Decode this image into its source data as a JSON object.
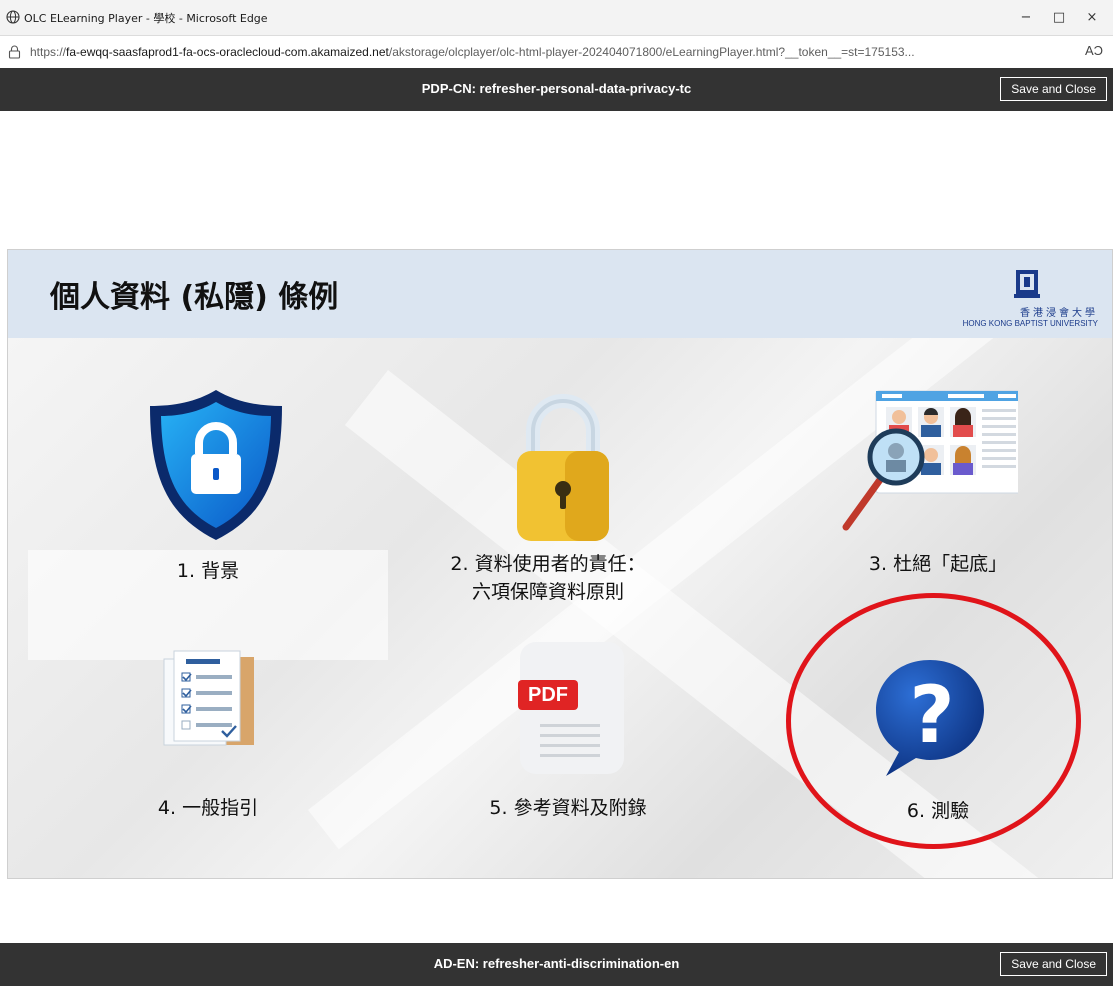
{
  "window": {
    "title": "OLC ELearning Player - 學校 - Microsoft Edge",
    "minimize": "−",
    "maximize": "□",
    "close": "×"
  },
  "address_bar": {
    "prefix": "https://",
    "domain": "fa-ewqq-saasfaprod1-fa-ocs-oraclecloud-com.akamaized.net",
    "path": "/akstorage/olcplayer/olc-html-player-202404071800/eLearningPlayer.html?__token__=st=175153...",
    "read_aloud_icon": "AƆ"
  },
  "course_top": {
    "title": "PDP-CN: refresher-personal-data-privacy-tc",
    "save_close": "Save and Close"
  },
  "slide": {
    "title": "個人資料 (私隱) 條例",
    "logo_cn": "香港浸會大學",
    "logo_en": "HONG KONG BAPTIST UNIVERSITY",
    "items": [
      {
        "label": "1. 背景",
        "icon": "shield-lock-icon"
      },
      {
        "label": "2. 資料使用者的責任：",
        "label2": "六項保障資料原則",
        "icon": "padlock-icon"
      },
      {
        "label": "3. 杜絕「起底」",
        "icon": "magnifier-profiles-icon"
      },
      {
        "label": "4. 一般指引",
        "icon": "checklist-documents-icon"
      },
      {
        "label": "5. 參考資料及附錄",
        "icon": "pdf-file-icon"
      },
      {
        "label": "6. 測驗",
        "icon": "question-bubble-icon"
      }
    ],
    "pdf_text": "PDF",
    "accent_blue": "#0b3d91",
    "annotation_color": "#e0141a"
  },
  "course_bottom": {
    "title": "AD-EN: refresher-anti-discrimination-en",
    "save_close": "Save and Close"
  }
}
